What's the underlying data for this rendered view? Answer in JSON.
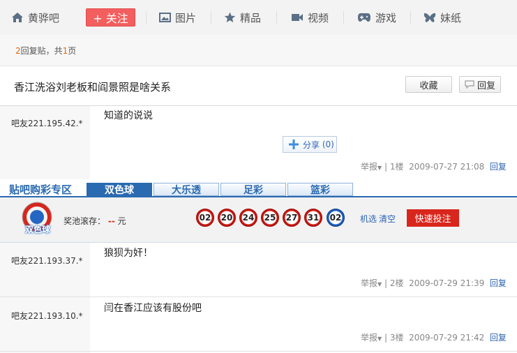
{
  "nav": {
    "forum_name": "黄骅吧",
    "follow_label": "+ 关注",
    "items": [
      {
        "label": "图片",
        "icon": "image-icon"
      },
      {
        "label": "精品",
        "icon": "star-icon"
      },
      {
        "label": "视频",
        "icon": "video-icon"
      },
      {
        "label": "游戏",
        "icon": "gamepad-icon"
      },
      {
        "label": "妹纸",
        "icon": "butterfly-icon"
      }
    ]
  },
  "thread_info": {
    "reply_count": "2",
    "reply_text": "回复贴，共",
    "page_count": "1",
    "page_unit": "页"
  },
  "thread": {
    "title": "香江洗浴刘老板和阎景照是啥关系",
    "collect_label": "收藏",
    "reply_label": "回复"
  },
  "posts": [
    {
      "user": "吧友221.195.42.*",
      "content": "知道的说说",
      "report": "举报",
      "floor": "1楼",
      "time": "2009-07-27 21:08",
      "reply": "回复",
      "share_label": "分享",
      "share_count": "(0)"
    },
    {
      "user": "吧友221.193.37.*",
      "content": "狼狈为奸！",
      "report": "举报",
      "floor": "2楼",
      "time": "2009-07-29 21:39",
      "reply": "回复"
    },
    {
      "user": "吧友221.193.10.*",
      "content": "闫在香江应该有股份吧",
      "report": "举报",
      "floor": "3楼",
      "time": "2009-07-29 21:42",
      "reply": "回复"
    }
  ],
  "lottery": {
    "zone_title": "贴吧购彩专区",
    "tabs": [
      "双色球",
      "大乐透",
      "足彩",
      "篮彩"
    ],
    "active_tab": 0,
    "logo_text": "双色球",
    "pool_label": "奖池滚存：",
    "pool_value": "--",
    "pool_unit": "元",
    "red_balls": [
      "02",
      "20",
      "24",
      "25",
      "27",
      "31"
    ],
    "blue_balls": [
      "02"
    ],
    "random_label": "机选",
    "clear_label": "清空",
    "bet_label": "快速投注"
  },
  "colors": {
    "accent_blue": "#2a6ab0",
    "follow_red": "#f35e5e",
    "bet_red": "#d9261c",
    "link": "#2d64b3"
  }
}
